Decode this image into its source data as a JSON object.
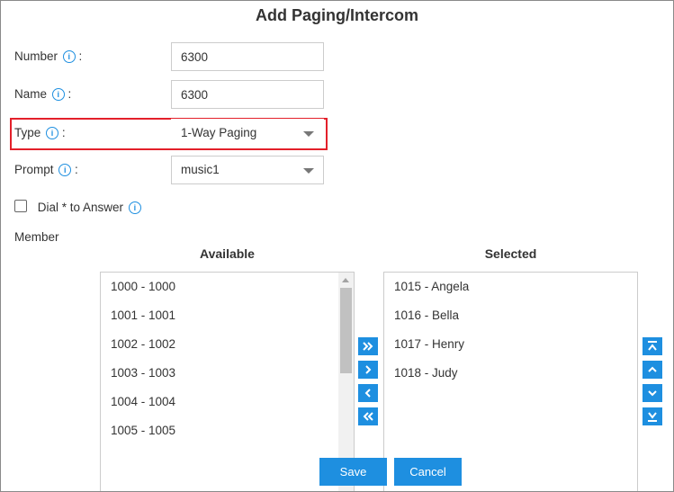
{
  "dialog": {
    "title": "Add Paging/Intercom"
  },
  "form": {
    "number": {
      "label": "Number",
      "value": "6300"
    },
    "name": {
      "label": "Name",
      "value": "6300"
    },
    "type": {
      "label": "Type",
      "value": "1-Way Paging"
    },
    "prompt": {
      "label": "Prompt",
      "value": "music1"
    },
    "dial_answer": {
      "label": "Dial * to Answer",
      "checked": false
    },
    "colon": ":",
    "info_glyph": "i"
  },
  "member": {
    "label": "Member",
    "available_title": "Available",
    "selected_title": "Selected",
    "available": [
      "1000 - 1000",
      "1001 - 1001",
      "1002 - 1002",
      "1003 - 1003",
      "1004 - 1004",
      "1005 - 1005"
    ],
    "selected": [
      "1015 - Angela",
      "1016 - Bella",
      "1017 - Henry",
      "1018 - Judy"
    ]
  },
  "icons": {
    "info": "info-circle-icon",
    "move_all_right": "double-chevron-right-icon",
    "move_right": "chevron-right-icon",
    "move_left": "chevron-left-icon",
    "move_all_left": "double-chevron-left-icon",
    "move_top": "move-to-top-icon",
    "move_up": "chevron-up-icon",
    "move_down": "chevron-down-icon",
    "move_bottom": "move-to-bottom-icon"
  },
  "buttons": {
    "save": "Save",
    "cancel": "Cancel"
  },
  "colors": {
    "accent": "#1e8fe0",
    "highlight": "#e3202a",
    "text": "#333333"
  }
}
